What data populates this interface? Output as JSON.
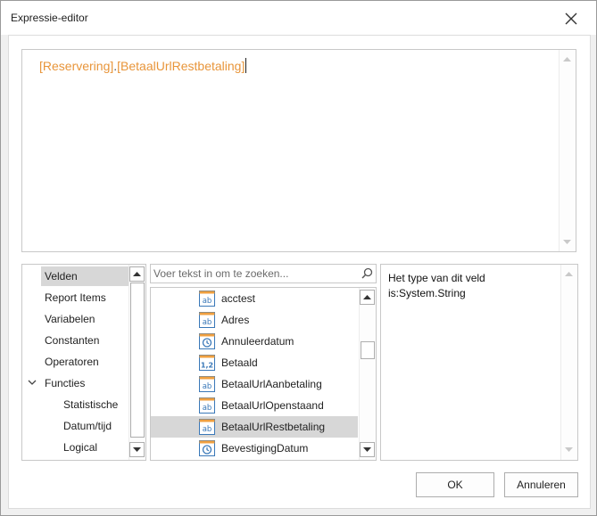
{
  "window": {
    "title": "Expressie-editor"
  },
  "editor": {
    "part1": "[Reservering]",
    "separator": ".",
    "part2": "[BetaalUrlRestbetaling]"
  },
  "categories": [
    {
      "label": "Velden",
      "selected": true
    },
    {
      "label": "Report Items"
    },
    {
      "label": "Variabelen"
    },
    {
      "label": "Constanten"
    },
    {
      "label": "Operatoren"
    },
    {
      "label": "Functies",
      "expanded": true
    },
    {
      "label": "Statistische"
    },
    {
      "label": "Datum/tijd"
    },
    {
      "label": "Logical"
    }
  ],
  "search": {
    "placeholder": "Voer tekst in om te zoeken..."
  },
  "fields": [
    {
      "label": "acctest",
      "type": "string-icon"
    },
    {
      "label": "Adres",
      "type": "string-icon"
    },
    {
      "label": "Annuleerdatum",
      "type": "clock-icon"
    },
    {
      "label": "Betaald",
      "type": "number-icon"
    },
    {
      "label": "BetaalUrlAanbetaling",
      "type": "string-icon"
    },
    {
      "label": "BetaalUrlOpenstaand",
      "type": "string-icon"
    },
    {
      "label": "BetaalUrlRestbetaling",
      "type": "string-icon",
      "selected": true
    },
    {
      "label": "BevestigingDatum",
      "type": "clock-icon"
    }
  ],
  "info": {
    "line1": "Het type van dit veld",
    "line2": "is:System.String"
  },
  "buttons": {
    "ok": "OK",
    "cancel": "Annuleren"
  },
  "colors": {
    "expression": "#e8953a",
    "icon_orange": "#f0a040",
    "icon_blue": "#3a78b8",
    "selected_bg": "#d7d7d7"
  }
}
